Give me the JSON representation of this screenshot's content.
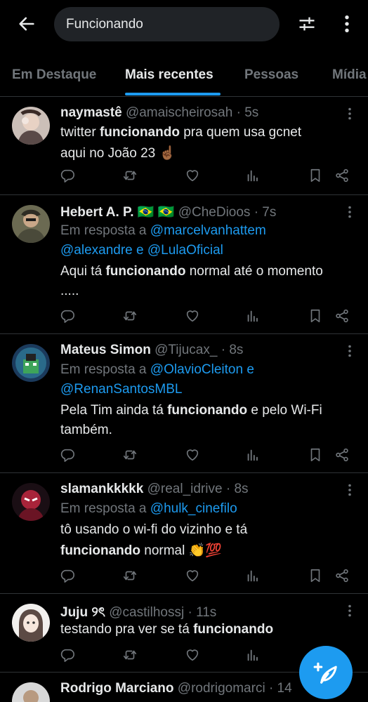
{
  "search": {
    "query": "Funcionando"
  },
  "tabs": [
    {
      "label": "Em Destaque"
    },
    {
      "label": "Mais recentes"
    },
    {
      "label": "Pessoas"
    },
    {
      "label": "Mídia"
    }
  ],
  "reply_prefix": "Em resposta a",
  "conj_e": "e",
  "tweets": [
    {
      "name": "naymastê",
      "handle": "@amaischeirosah",
      "time": "· 5s",
      "line1_a": "twitter ",
      "line1_kw": "funcionando",
      "line1_b": " pra quem usa gcnet",
      "line2": "aqui no João 23 ☝🏾"
    },
    {
      "name": "Hebert A. P. 🇧🇷 🇧🇷",
      "handle": "@CheDioos",
      "time": "· 7s",
      "mention1": "@marcelvanhattem",
      "mention2": "@alexandre",
      "mention3": "@LulaOficial",
      "line1_a": "Aqui tá ",
      "line1_kw": "funcionando",
      "line1_b": " normal até o momento",
      "line2": "....."
    },
    {
      "name": "Mateus Simon",
      "handle": "@Tijucax_",
      "time": "· 8s",
      "mention1": "@OlavioCleiton",
      "mention2": "@RenanSantosMBL",
      "line1_a": "Pela Tim ainda tá ",
      "line1_kw": "funcionando",
      "line1_b": " e pelo Wi-Fi",
      "line2": "também."
    },
    {
      "name": "slamankkkkk",
      "handle": "@real_idrive",
      "time": "· 8s",
      "mention1": "@hulk_cinefilo",
      "line1": "tô usando o wi-fi do vizinho e tá",
      "line2_kw": "funcionando",
      "line2_b": " normal 👏💯"
    },
    {
      "name": "Juju ୨ৎ",
      "handle": "@castilhossj",
      "time": "· 11s",
      "line1_a": "testando pra ver se tá ",
      "line1_kw": "funcionando"
    },
    {
      "name": "Rodrigo Marciano",
      "handle": "@rodrigomarci",
      "time": "· 14"
    }
  ],
  "icons": {
    "back": "arrow-left-icon",
    "filter": "sliders-icon",
    "more": "more-vertical-icon",
    "reply": "comment-icon",
    "retweet": "retweet-icon",
    "like": "heart-icon",
    "views": "analytics-icon",
    "bookmark": "bookmark-icon",
    "share": "share-icon",
    "compose": "compose-feather-icon"
  },
  "colors": {
    "background": "#000000",
    "accent": "#1d9bf0",
    "text": "#e7e9ea",
    "muted": "#71767b",
    "divider": "#2f3336",
    "search_bg": "#202327"
  }
}
